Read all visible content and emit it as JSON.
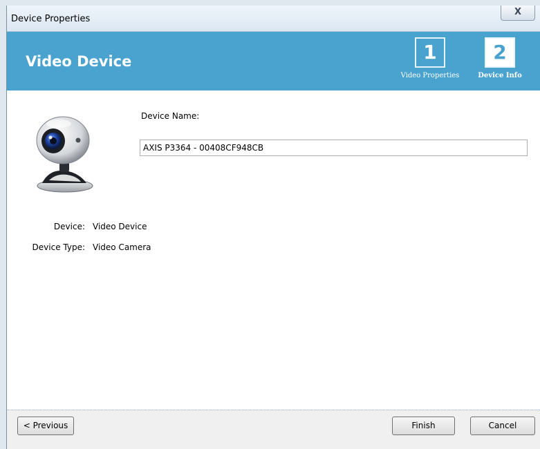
{
  "window": {
    "title": "Device Properties",
    "close_glyph": "X"
  },
  "banner": {
    "title": "Video Device",
    "steps": [
      {
        "number": "1",
        "label": "Video Properties",
        "active": false
      },
      {
        "number": "2",
        "label": "Device Info",
        "active": true
      }
    ]
  },
  "form": {
    "device_name_label": "Device Name:",
    "device_name_value": "AXIS P3364 - 00408CF948CB",
    "properties": [
      {
        "label": "Device:",
        "value": "Video Device"
      },
      {
        "label": "Device Type:",
        "value": "Video Camera"
      }
    ],
    "image_icon": "webcam-icon"
  },
  "footer": {
    "previous_label": "< Previous",
    "finish_label": "Finish",
    "cancel_label": "Cancel"
  },
  "colors": {
    "banner": "#4aa3cf",
    "banner_text": "#ffffff",
    "footer": "#f0f0f0"
  }
}
